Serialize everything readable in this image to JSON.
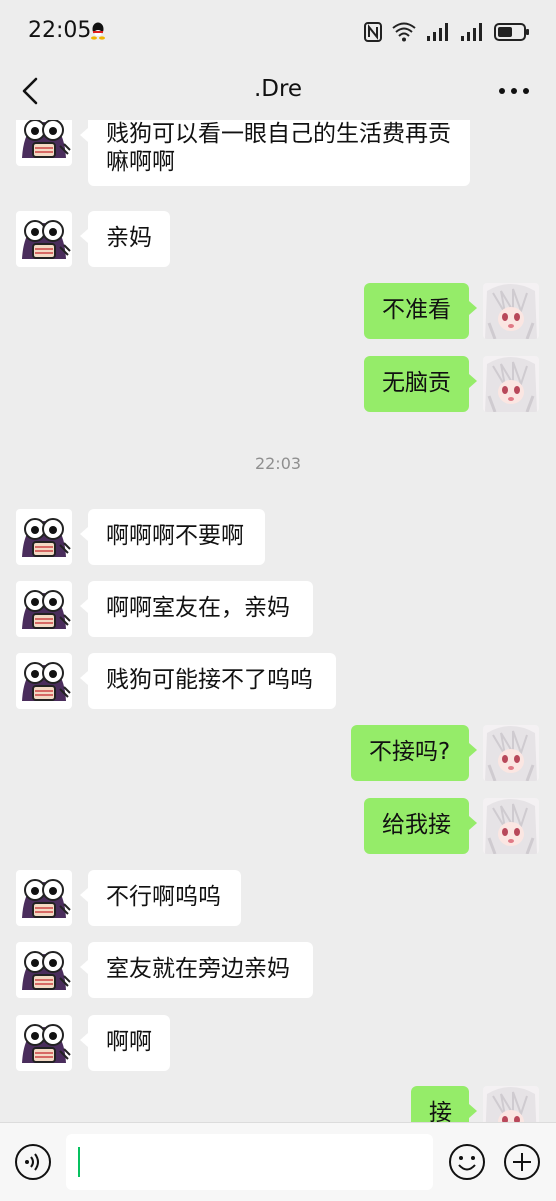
{
  "status_bar": {
    "time": "22:05",
    "icons": [
      "qq-icon",
      "nfc-icon",
      "wifi-icon",
      "signal-icon",
      "signal-icon",
      "battery-icon"
    ]
  },
  "header": {
    "title": ".Dre",
    "back_icon": "chevron-left-icon",
    "more_icon": "more-dots-icon"
  },
  "messages": [
    {
      "side": "left",
      "lines": [
        "贱狗可以看一眼自己的生活费再贡",
        "嘛啊啊"
      ]
    },
    {
      "side": "left",
      "lines": [
        "亲妈"
      ]
    },
    {
      "side": "right",
      "lines": [
        "不准看"
      ]
    },
    {
      "side": "right",
      "lines": [
        "无脑贡"
      ]
    },
    {
      "timestamp": "22:03"
    },
    {
      "side": "left",
      "lines": [
        "啊啊啊不要啊"
      ]
    },
    {
      "side": "left",
      "lines": [
        "啊啊室友在，亲妈"
      ]
    },
    {
      "side": "left",
      "lines": [
        "贱狗可能接不了呜呜"
      ]
    },
    {
      "side": "right",
      "lines": [
        "不接吗?"
      ]
    },
    {
      "side": "right",
      "lines": [
        "给我接"
      ]
    },
    {
      "side": "left",
      "lines": [
        "不行啊呜呜"
      ]
    },
    {
      "side": "left",
      "lines": [
        "室友就在旁边亲妈"
      ]
    },
    {
      "side": "left",
      "lines": [
        "啊啊"
      ]
    },
    {
      "side": "right",
      "lines": [
        "接"
      ]
    }
  ],
  "input_bar": {
    "voice_icon": "voice-icon",
    "text_value": "",
    "emoji_icon": "emoji-icon",
    "plus_icon": "plus-circle-icon"
  },
  "colors": {
    "background": "#ededed",
    "sent_bubble": "#95ec69",
    "received_bubble": "#ffffff",
    "caret": "#07c160"
  }
}
